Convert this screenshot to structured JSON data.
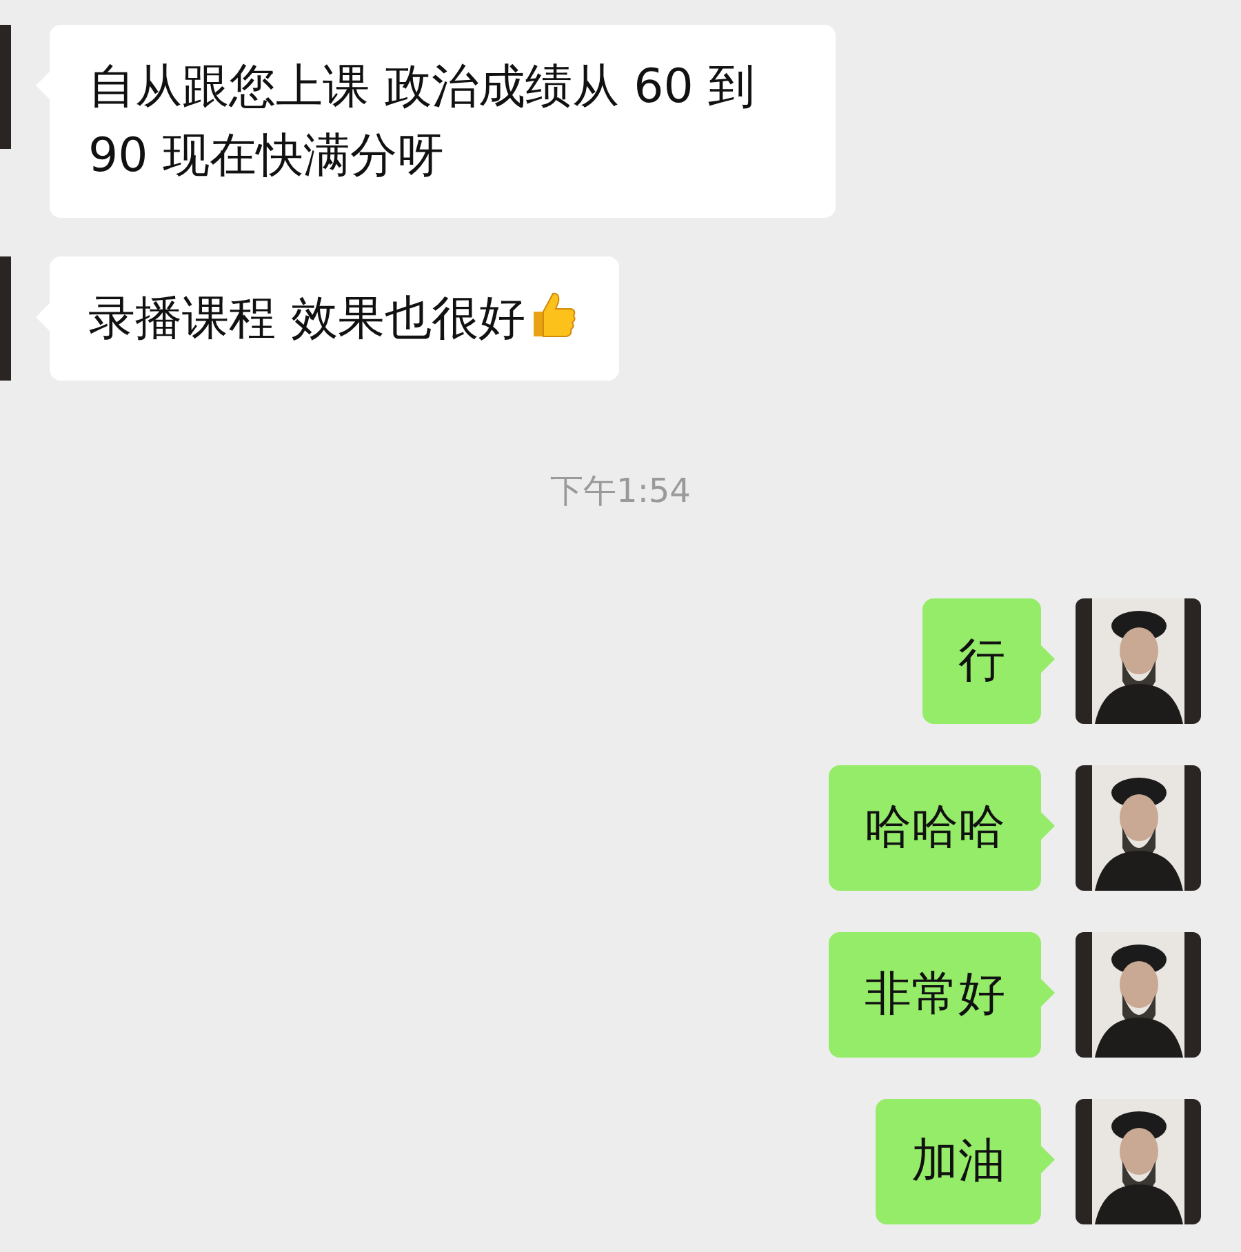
{
  "messages": [
    {
      "kind": "text",
      "outgoing": false,
      "text": "自从跟您上课 政治成绩从 60 到 90 现在快满分呀",
      "thumbs_up": false
    },
    {
      "kind": "text",
      "outgoing": false,
      "text": "录播课程 效果也很好",
      "thumbs_up": true
    },
    {
      "kind": "time",
      "text": "下午1:54"
    },
    {
      "kind": "text",
      "outgoing": true,
      "text": "行",
      "thumbs_up": false
    },
    {
      "kind": "text",
      "outgoing": true,
      "text": "哈哈哈",
      "thumbs_up": false
    },
    {
      "kind": "text",
      "outgoing": true,
      "text": "非常好",
      "thumbs_up": false
    },
    {
      "kind": "text",
      "outgoing": true,
      "text": "加油",
      "thumbs_up": false
    }
  ]
}
